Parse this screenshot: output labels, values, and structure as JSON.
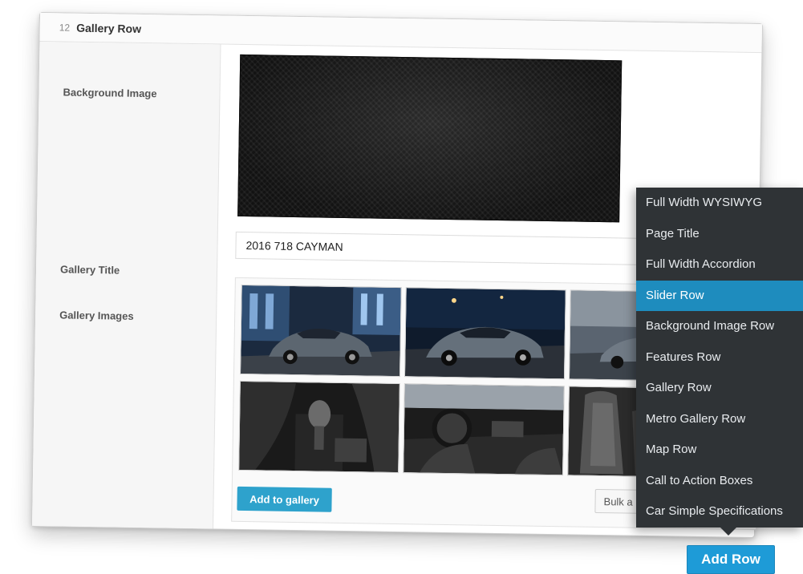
{
  "panel": {
    "row_number": "12",
    "row_title": "Gallery Row"
  },
  "fields": {
    "background_image_label": "Background Image",
    "gallery_title_label": "Gallery Title",
    "gallery_title_value": "2016 718 CAYMAN",
    "gallery_images_label": "Gallery Images"
  },
  "gallery": {
    "add_to_gallery_label": "Add to gallery",
    "bulk_button_label": "Bulk a"
  },
  "row_menu": {
    "items": [
      "Full Width WYSIWYG",
      "Page Title",
      "Full Width Accordion",
      "Slider Row",
      "Background Image Row",
      "Features Row",
      "Gallery Row",
      "Metro Gallery Row",
      "Map Row",
      "Call to Action Boxes",
      "Car Simple Specifications"
    ],
    "active_item": "Slider Row"
  },
  "add_row_label": "Add Row",
  "colors": {
    "accent": "#1e9bd7",
    "menu_bg": "#2f3336",
    "menu_active": "#1e8cbe",
    "button_blue": "#2ea2cc"
  }
}
